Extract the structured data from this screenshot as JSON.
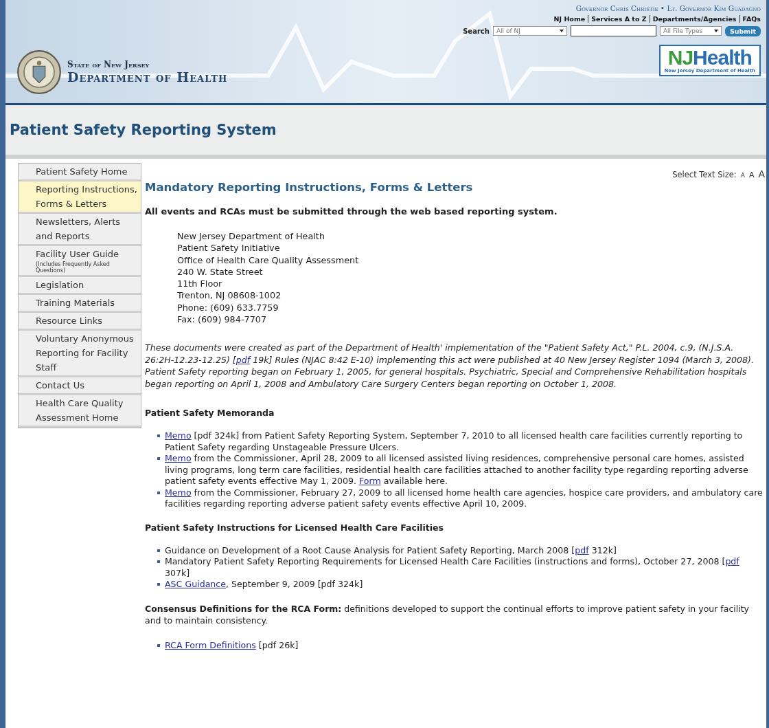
{
  "header": {
    "governor_line": "Governor Chris Christie • Lt. Governor Kim Guadagno",
    "nav_links": [
      "NJ Home",
      "Services A to Z",
      "Departments/Agencies",
      "FAQs"
    ],
    "search": {
      "label": "Search",
      "scope": "All of NJ",
      "file_types": "All File Types",
      "button": "Submit"
    },
    "agency": {
      "state": "State of New Jersey",
      "department": "Department of Health"
    },
    "logo": {
      "nj": "NJ",
      "health": "Health",
      "subtitle": "New Jersey Department of Health"
    }
  },
  "page_title": "Patient Safety Reporting System",
  "sidebar": {
    "items": [
      {
        "label": "Patient Safety Home",
        "selected": false
      },
      {
        "label": "Reporting Instructions, Forms & Letters",
        "selected": true
      },
      {
        "label": "Newsletters, Alerts and Reports",
        "selected": false
      },
      {
        "label": "Facility User Guide",
        "note": "(Includes Frequently Asked Questions)",
        "selected": false
      },
      {
        "label": "Legislation",
        "selected": false
      },
      {
        "label": "Training Materials",
        "selected": false
      },
      {
        "label": "Resource Links",
        "selected": false
      },
      {
        "label": "Voluntary Anonymous Reporting for Facility Staff",
        "selected": false
      },
      {
        "label": "Contact Us",
        "selected": false
      },
      {
        "label": "Health Care Quality Assessment Home",
        "selected": false
      }
    ]
  },
  "text_size": {
    "label": "Select Text Size:",
    "sizes": [
      "A",
      "A",
      "A"
    ]
  },
  "heading": "Mandatory Reporting Instructions, Forms & Letters",
  "notice": "All events and RCAs must be submitted through the web based reporting system.",
  "address": [
    "New Jersey Department of Health",
    "Patient Safety Initiative",
    "Office of Health Care Quality Assessment",
    "240 W. State Street",
    "11th Floor",
    "Trenton, NJ 08608-1002",
    "Phone: (609) 633.7759",
    "Fax: (609) 984-7707"
  ],
  "intro": [
    {
      "text": "These documents were created as part of the Department of Health' implementation of the \"Patient Safety Act,\" P.L. 2004, c.9, (N.J.S.A. 26:2H-12.23-12.25) [",
      "link": false
    },
    {
      "text": "pdf",
      "link": true
    },
    {
      "text": " 19k] Rules (NJAC 8:42 E-10) implementing this act were published at 40 New Jersey Register 1094 (March 3, 2008). Patient Safety reporting began on February 1, 2005, for general hospitals. Psychiatric, Special and Comprehensive Rehabilitation hospitals began reporting on April 1, 2008 and Ambulatory Care Surgery Centers began reporting on October 1, 2008.",
      "link": false
    }
  ],
  "sections": [
    {
      "title": "Patient Safety Memoranda",
      "items": [
        [
          {
            "text": "Memo",
            "link": true
          },
          {
            "text": " [pdf 324k] from Patient Safety Reporting System, September 7, 2010 to all licensed health care facilities currently reporting to Patient Safety regarding Unstageable Pressure Ulcers.",
            "link": false
          }
        ],
        [
          {
            "text": "Memo",
            "link": true
          },
          {
            "text": " from the Commissioner, April 28, 2009 to all licensed assisted living residences, comprehensive personal care homes, assisted living programs, long term care facilities, residential health care facilities attached to another facility type regarding reporting adverse patient safety events effective May 1, 2009. ",
            "link": false
          },
          {
            "text": "Form",
            "link": true
          },
          {
            "text": " available here.",
            "link": false
          }
        ],
        [
          {
            "text": "Memo",
            "link": true
          },
          {
            "text": " from the Commissioner, February 27, 2009 to all licensed home health care agencies, hospice care providers, and ambulatory care facilities regarding reporting adverse patient safety events effective April 10, 2009.",
            "link": false
          }
        ]
      ]
    },
    {
      "title": "Patient Safety Instructions for Licensed Health Care Facilities",
      "items": [
        [
          {
            "text": "Guidance on Development of a Root Cause Analysis for Patient Safety Reporting, March 2008 [",
            "link": false
          },
          {
            "text": "pdf",
            "link": true
          },
          {
            "text": " 312k]",
            "link": false
          }
        ],
        [
          {
            "text": "Mandatory Patient Safety Reporting Requirements for Licensed Health Care Facilities (instructions and forms), October 27, 2008 [",
            "link": false
          },
          {
            "text": "pdf",
            "link": true
          },
          {
            "text": " 307k]",
            "link": false
          }
        ],
        [
          {
            "text": "ASC Guidance",
            "link": true
          },
          {
            "text": ", September 9, 2009 [pdf 324k]",
            "link": false
          }
        ]
      ]
    },
    {
      "lead": [
        {
          "text": "**Consensus Definitions for the RCA Form:** definitions developed to support the continual efforts to improve patient safety in your facility and to maintain consistency.",
          "link": false
        }
      ],
      "items": [
        [
          {
            "text": "RCA Form Definitions",
            "link": true
          },
          {
            "text": " [pdf 26k]",
            "link": false
          }
        ]
      ]
    }
  ]
}
